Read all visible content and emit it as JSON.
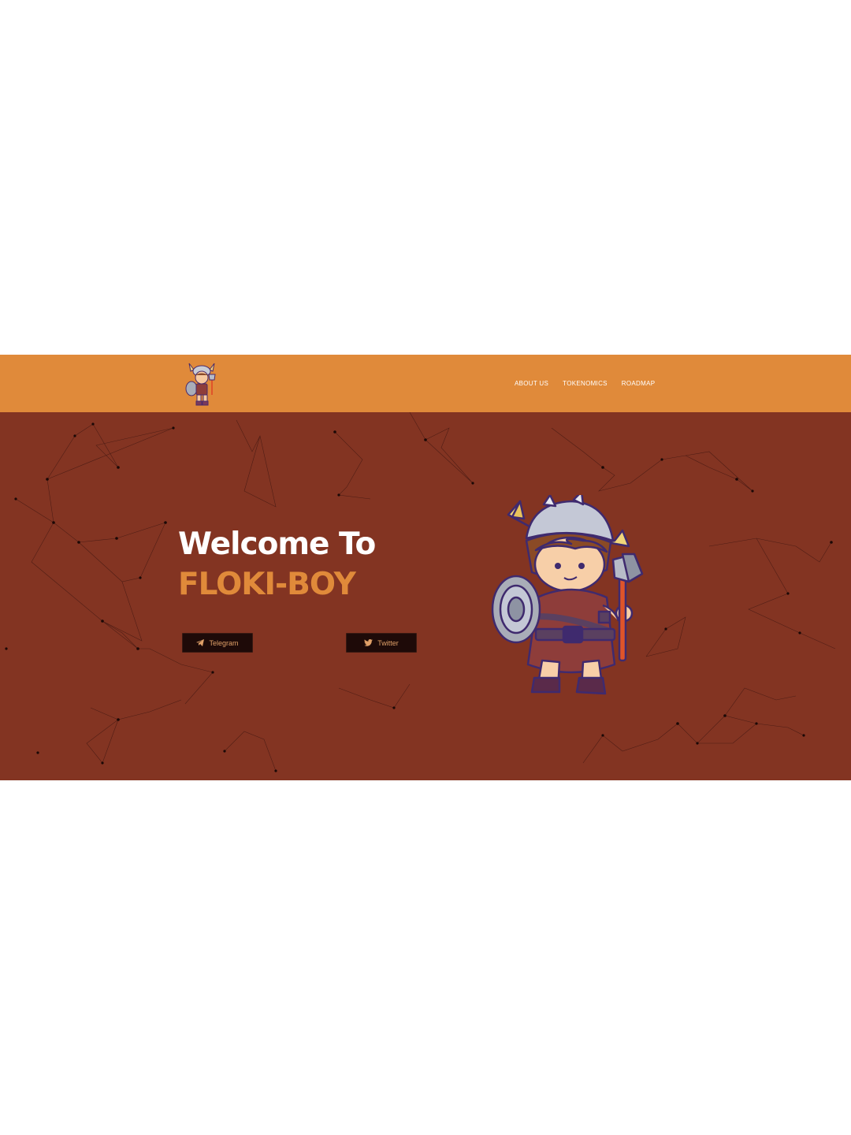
{
  "header": {
    "logo_icon": "viking-boy-logo-icon",
    "nav": [
      {
        "label": "ABOUT US"
      },
      {
        "label": "TOKENOMICS"
      },
      {
        "label": "ROADMAP"
      }
    ],
    "background_color": "#e08a3a"
  },
  "hero": {
    "title_line1": "Welcome To",
    "title_line2": "FLOKI-BOY",
    "buttons": {
      "telegram": {
        "label": "Telegram",
        "icon": "telegram-icon"
      },
      "twitter": {
        "label": "Twitter",
        "icon": "twitter-icon"
      }
    },
    "mascot_icon": "viking-boy-mascot",
    "background_color": "#833422",
    "accent_color": "#e08a3a"
  }
}
